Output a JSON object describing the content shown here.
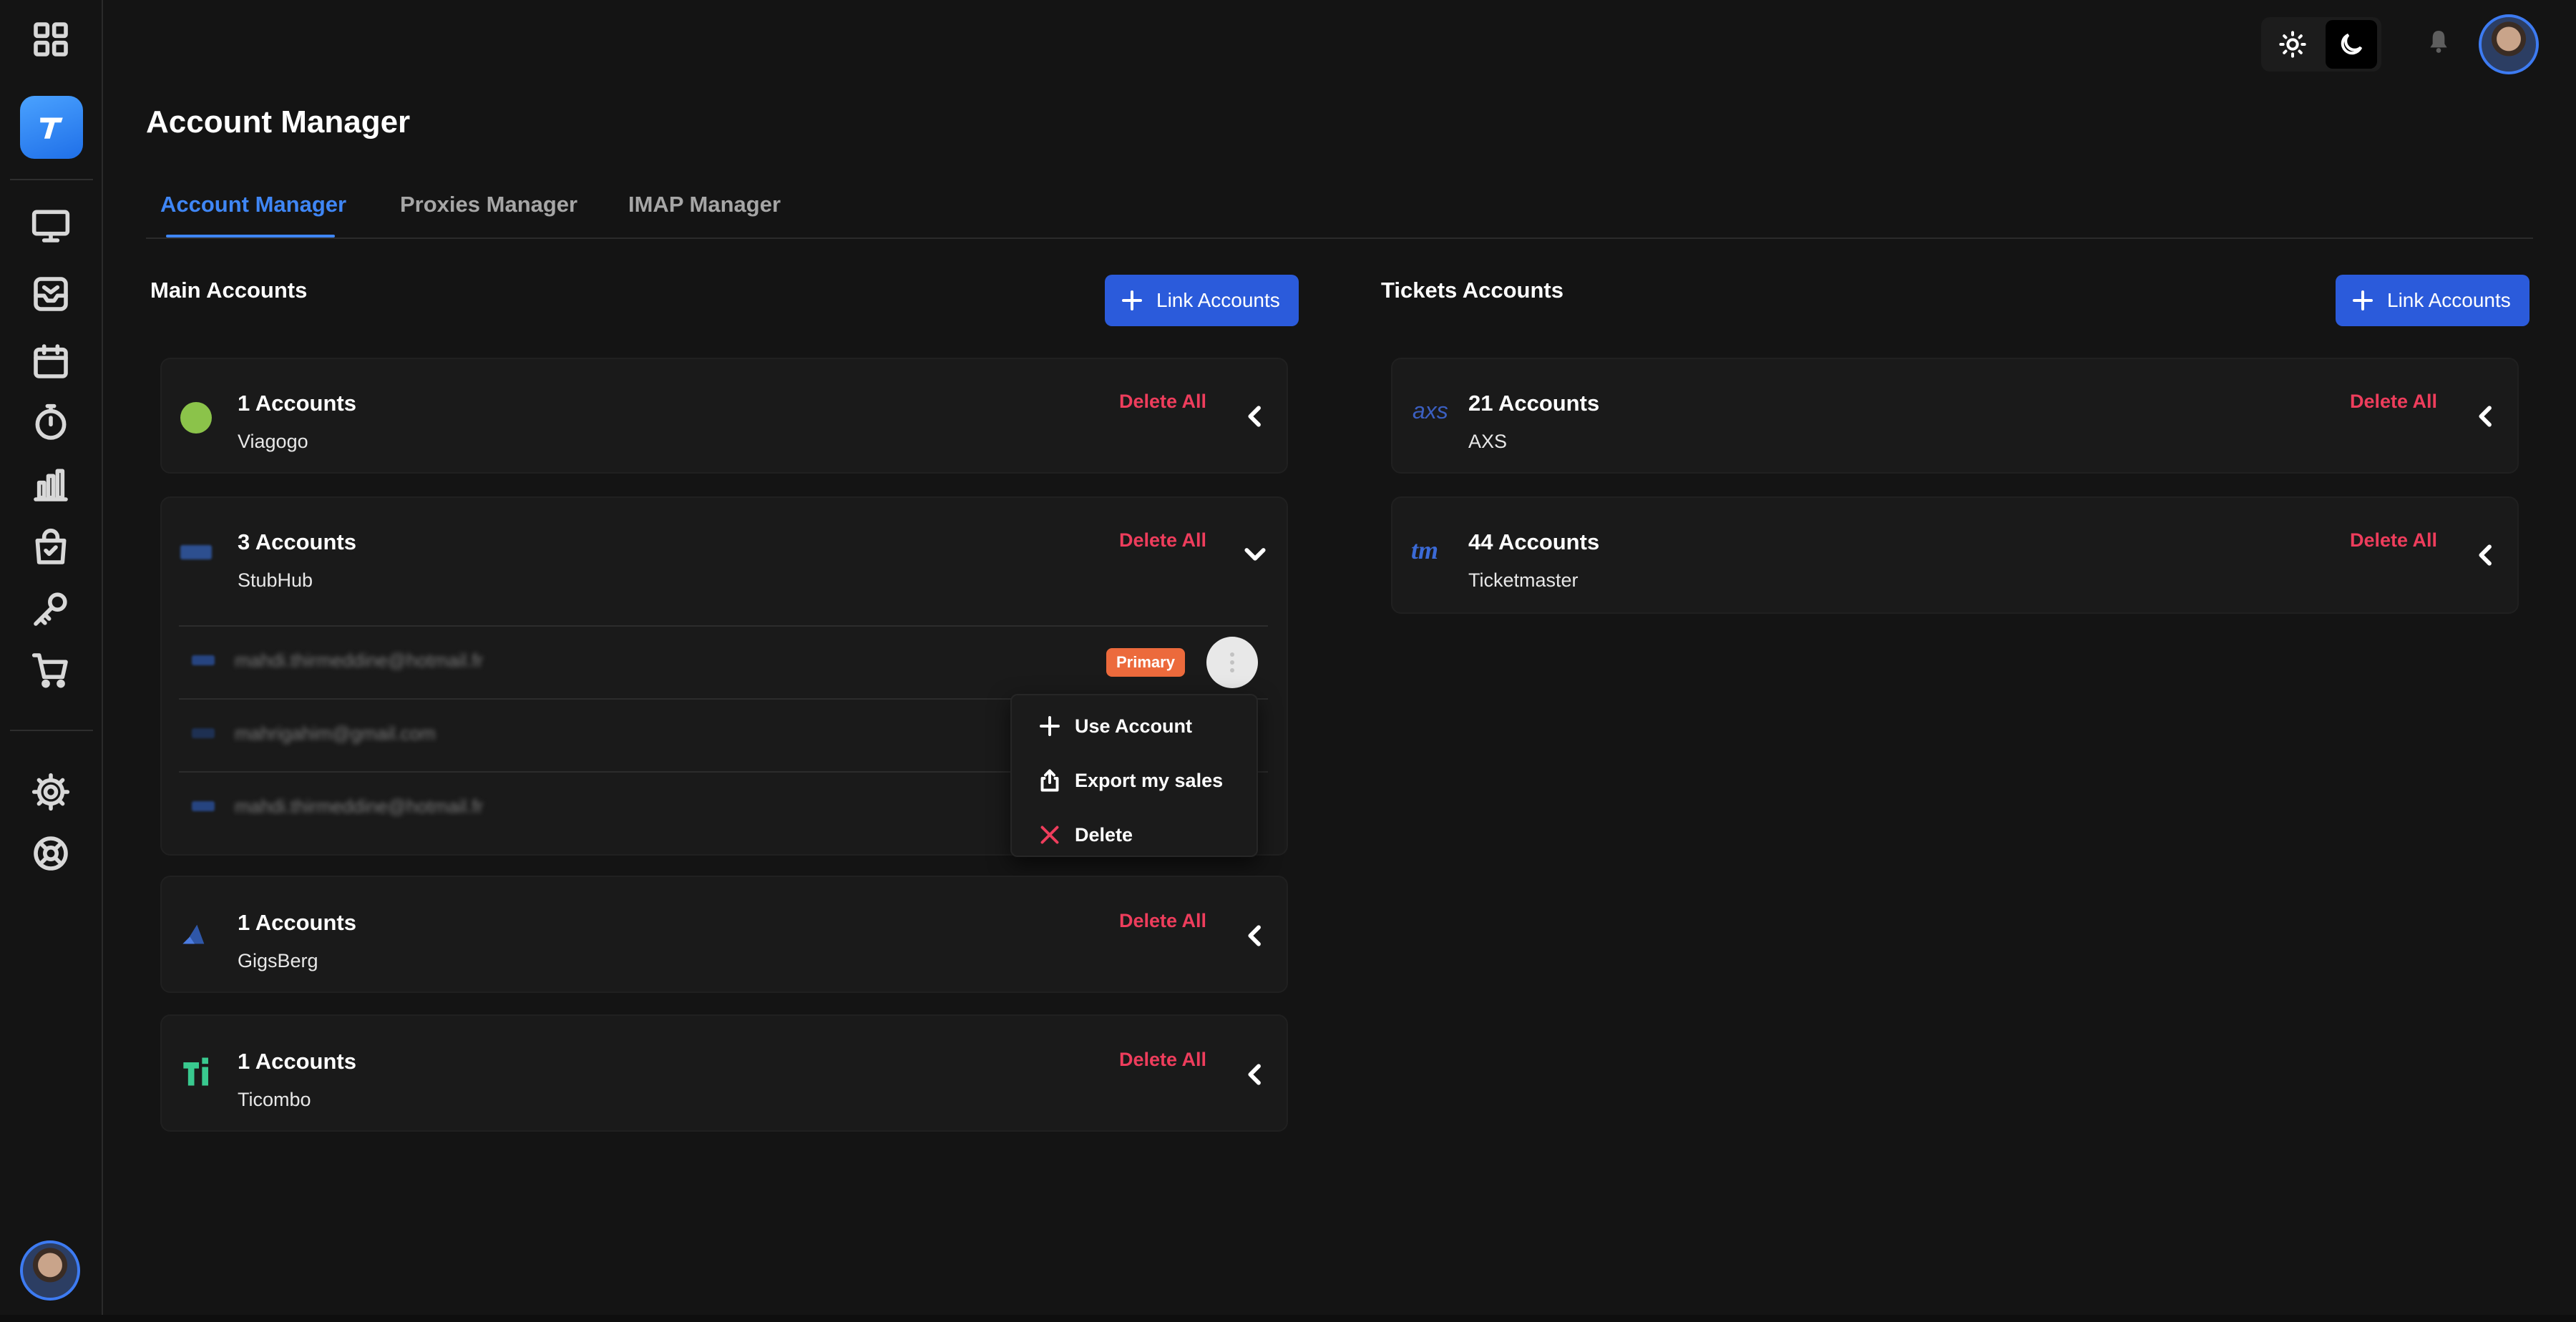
{
  "header": {
    "title": "Account Manager"
  },
  "theme": {
    "light_icon": "sun-icon",
    "dark_icon": "moon-icon",
    "active": "dark"
  },
  "notifications_icon": "bell-icon",
  "tabs": [
    {
      "label": "Account Manager",
      "active": true
    },
    {
      "label": "Proxies Manager",
      "active": false
    },
    {
      "label": "IMAP Manager",
      "active": false
    }
  ],
  "main_accounts": {
    "title": "Main Accounts",
    "link_button": "Link Accounts",
    "groups": [
      {
        "count": "1 Accounts",
        "provider": "Viagogo",
        "delete_all": "Delete All",
        "expanded": false
      },
      {
        "count": "3 Accounts",
        "provider": "StubHub",
        "delete_all": "Delete All",
        "expanded": true,
        "accounts": [
          {
            "email": "mahdi.thirmeddine@hotmail.fr",
            "badge": "Primary"
          },
          {
            "email": "mahrigahim@gmail.com",
            "badge": ""
          },
          {
            "email": "mahdi.thirmeddine@hotmail.fr",
            "badge": ""
          }
        ]
      },
      {
        "count": "1 Accounts",
        "provider": "GigsBerg",
        "delete_all": "Delete All",
        "expanded": false
      },
      {
        "count": "1 Accounts",
        "provider": "Ticombo",
        "delete_all": "Delete All",
        "expanded": false
      }
    ]
  },
  "context_menu": {
    "items": [
      {
        "label": "Use Account",
        "icon": "plus-icon"
      },
      {
        "label": "Export my sales",
        "icon": "share-icon"
      },
      {
        "label": "Delete",
        "icon": "close-icon"
      }
    ]
  },
  "ticket_accounts": {
    "title": "Tickets Accounts",
    "link_button": "Link Accounts",
    "groups": [
      {
        "count": "21 Accounts",
        "provider": "AXS",
        "logo_text": "axs",
        "delete_all": "Delete All",
        "expanded": false
      },
      {
        "count": "44 Accounts",
        "provider": "Ticketmaster",
        "logo_text": "tm",
        "delete_all": "Delete All",
        "expanded": false
      }
    ]
  },
  "colors": {
    "accent": "#3f86f5",
    "button": "#2b5bdb",
    "danger": "#ee3d5c",
    "badge": "#ec6a3c",
    "background": "#141414",
    "card": "#1a1a1a"
  }
}
